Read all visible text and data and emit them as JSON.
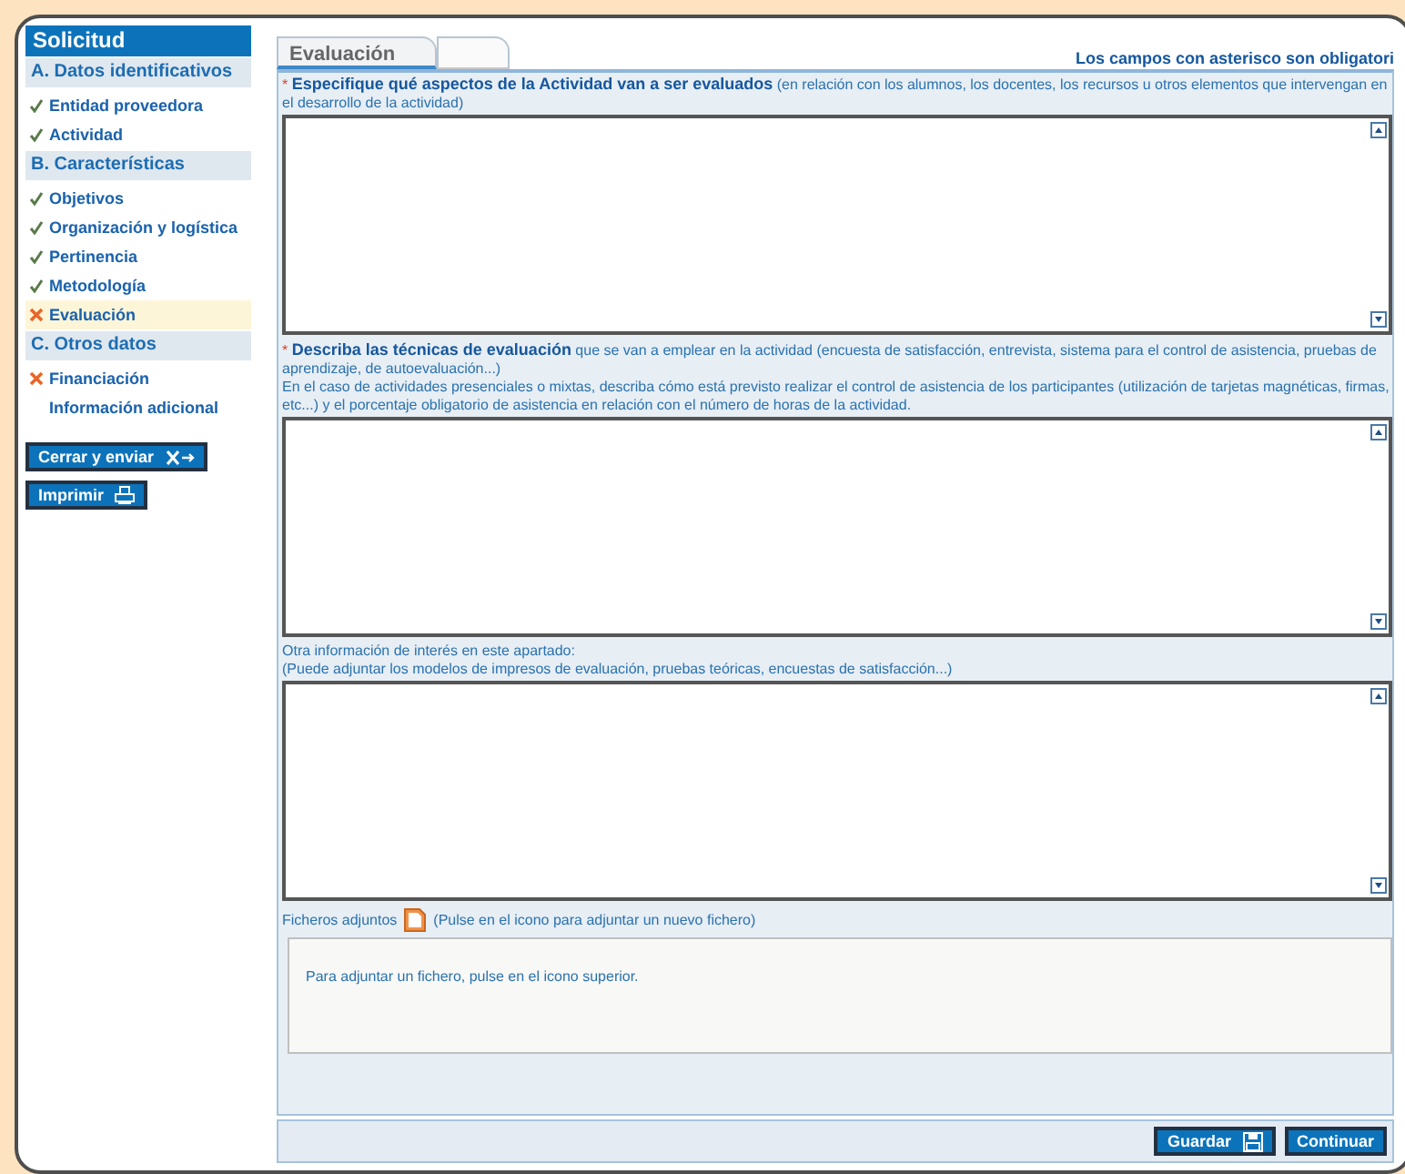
{
  "sidebar": {
    "title": "Solicitud",
    "sections": [
      {
        "title": "A. Datos identificativos",
        "items": [
          {
            "label": "Entidad proveedora",
            "kind": "done",
            "selected": false
          },
          {
            "label": "Actividad",
            "kind": "done",
            "selected": false
          }
        ]
      },
      {
        "title": "B. Características",
        "items": [
          {
            "label": "Objetivos",
            "kind": "done",
            "selected": false
          },
          {
            "label": "Organización y logística",
            "kind": "done",
            "selected": false
          },
          {
            "label": "Pertinencia",
            "kind": "done",
            "selected": false
          },
          {
            "label": "Metodología",
            "kind": "done",
            "selected": false
          },
          {
            "label": "Evaluación",
            "kind": "error",
            "selected": true
          }
        ]
      },
      {
        "title": "C. Otros datos",
        "items": [
          {
            "label": "Financiación",
            "kind": "error",
            "selected": false
          },
          {
            "label": "Información adicional",
            "kind": "plain",
            "selected": false
          }
        ]
      }
    ],
    "buttons": [
      {
        "label": "Cerrar y enviar",
        "kind": "exit"
      },
      {
        "label": "Imprimir",
        "kind": "printer"
      }
    ]
  },
  "tabs": [
    {
      "label": "Evaluación",
      "selected": true
    },
    {
      "selected": false
    }
  ],
  "required_note": "Los campos con asterisco son obligatori",
  "fields": [
    {
      "marker": "*",
      "label": "**Especifique qué aspectos de la Actividad van a ser evaluados** (en relación con los alumnos, los docentes, los recursos u otros elementos que intervengan en el desarrollo de la actividad)"
    },
    {
      "marker": "*",
      "label": "**Describa las técnicas de evaluación** que se van a emplear en la actividad (encuesta de satisfacción, entrevista, sistema para el control de asistencia, pruebas de aprendizaje, de autoevaluación...)\nEn el caso de actividades presenciales o mixtas, describa cómo está previsto realizar el control de asistencia de los participantes (utilización de tarjetas magnéticas, firmas, etc...) y el porcentaje obligatorio de asistencia en relación con el número de horas de la actividad."
    },
    {
      "label": "Otra información de interés en este apartado:\n(Puede adjuntar los modelos de impresos de evaluación, pruebas teóricas, encuestas de satisfacción...)"
    }
  ],
  "attachments": {
    "label": "Ficheros adjuntos",
    "hint": "(Pulse en el icono para adjuntar un nuevo fichero)",
    "empty_text": "Para adjuntar un fichero, pulse en el icono superior."
  },
  "actions": [
    {
      "label": "Guardar",
      "kind": "save"
    },
    {
      "label": "Continuar",
      "kind": "plain"
    }
  ]
}
